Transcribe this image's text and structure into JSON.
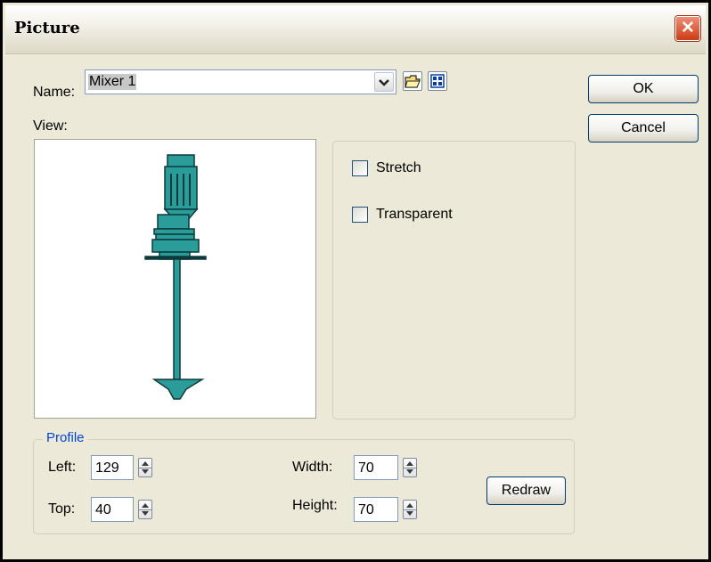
{
  "dialog": {
    "title": "Picture"
  },
  "name": {
    "label": "Name:",
    "value": "Mixer 1"
  },
  "view": {
    "label": "View:"
  },
  "buttons": {
    "ok": "OK",
    "cancel": "Cancel",
    "redraw": "Redraw"
  },
  "options": {
    "stretch": "Stretch",
    "transparent": "Transparent",
    "stretch_checked": false,
    "transparent_checked": false
  },
  "profile": {
    "legend": "Profile",
    "left_label": "Left:",
    "left_value": "129",
    "top_label": "Top:",
    "top_value": "40",
    "width_label": "Width:",
    "width_value": "70",
    "height_label": "Height:",
    "height_value": "70"
  },
  "icons": {
    "close": "close-icon",
    "dropdown": "chevron-down-icon",
    "open_folder": "open-folder-icon",
    "grid": "grid-icon"
  },
  "colors": {
    "mixer": "#2a9c9a",
    "accent_blue": "#0046d5",
    "close_red": "#cd3b17"
  }
}
